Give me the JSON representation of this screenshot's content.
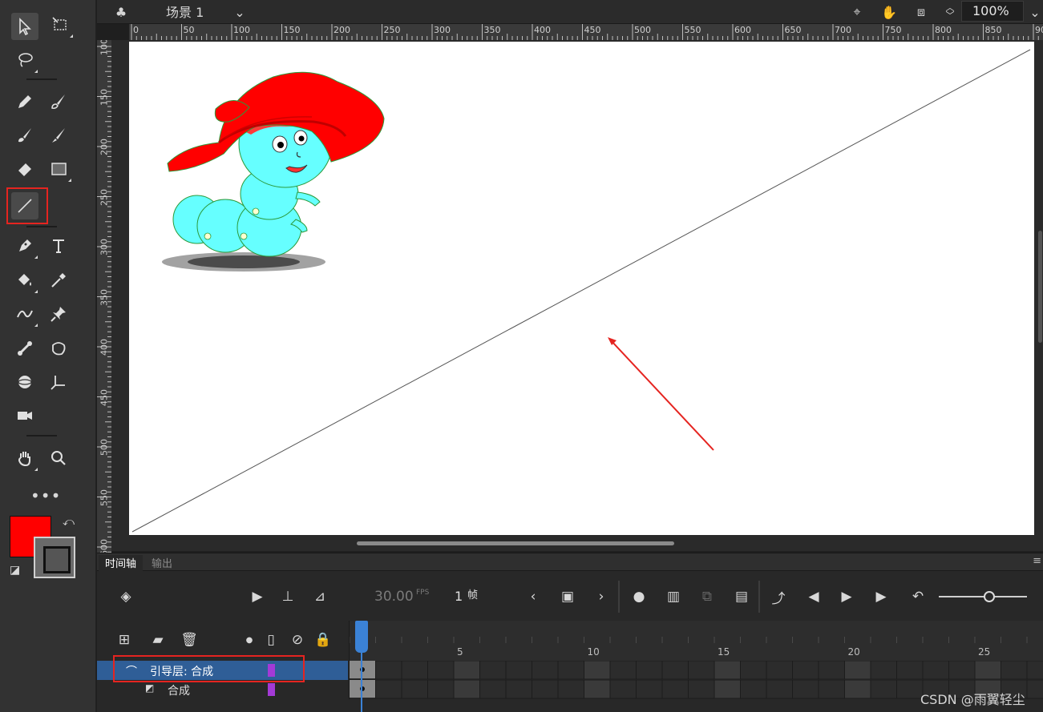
{
  "header": {
    "scene_label": "场景 1",
    "zoom": "100%"
  },
  "rulers": {
    "horizontal": [
      "0",
      "50",
      "100",
      "150",
      "200",
      "250",
      "300",
      "350",
      "400",
      "450",
      "500",
      "550",
      "600",
      "650",
      "700",
      "750",
      "800",
      "850",
      "90"
    ],
    "vertical": [
      "100",
      "150",
      "200",
      "250",
      "300",
      "350",
      "400",
      "450",
      "500",
      "550",
      "600"
    ]
  },
  "colors": {
    "fill": "#ff0000",
    "stroke": "#6a6a6a",
    "highlight": "#e52420",
    "selected_layer": "#2f5e97",
    "playhead": "#3b82d6",
    "layer_tag": "#a33ad6"
  },
  "timeline": {
    "tabs": [
      "时间轴",
      "输出"
    ],
    "fps_value": "30.00",
    "fps_unit": "FPS",
    "frame_number": "1",
    "frame_unit": "帧",
    "frame_ruler": [
      "5",
      "10",
      "15",
      "20",
      "25"
    ],
    "layers": [
      {
        "name": "引导层: 合成",
        "type": "guide",
        "selected": true
      },
      {
        "name": "合成",
        "type": "normal",
        "selected": false
      }
    ]
  },
  "watermark": "CSDN @雨翼轻尘"
}
